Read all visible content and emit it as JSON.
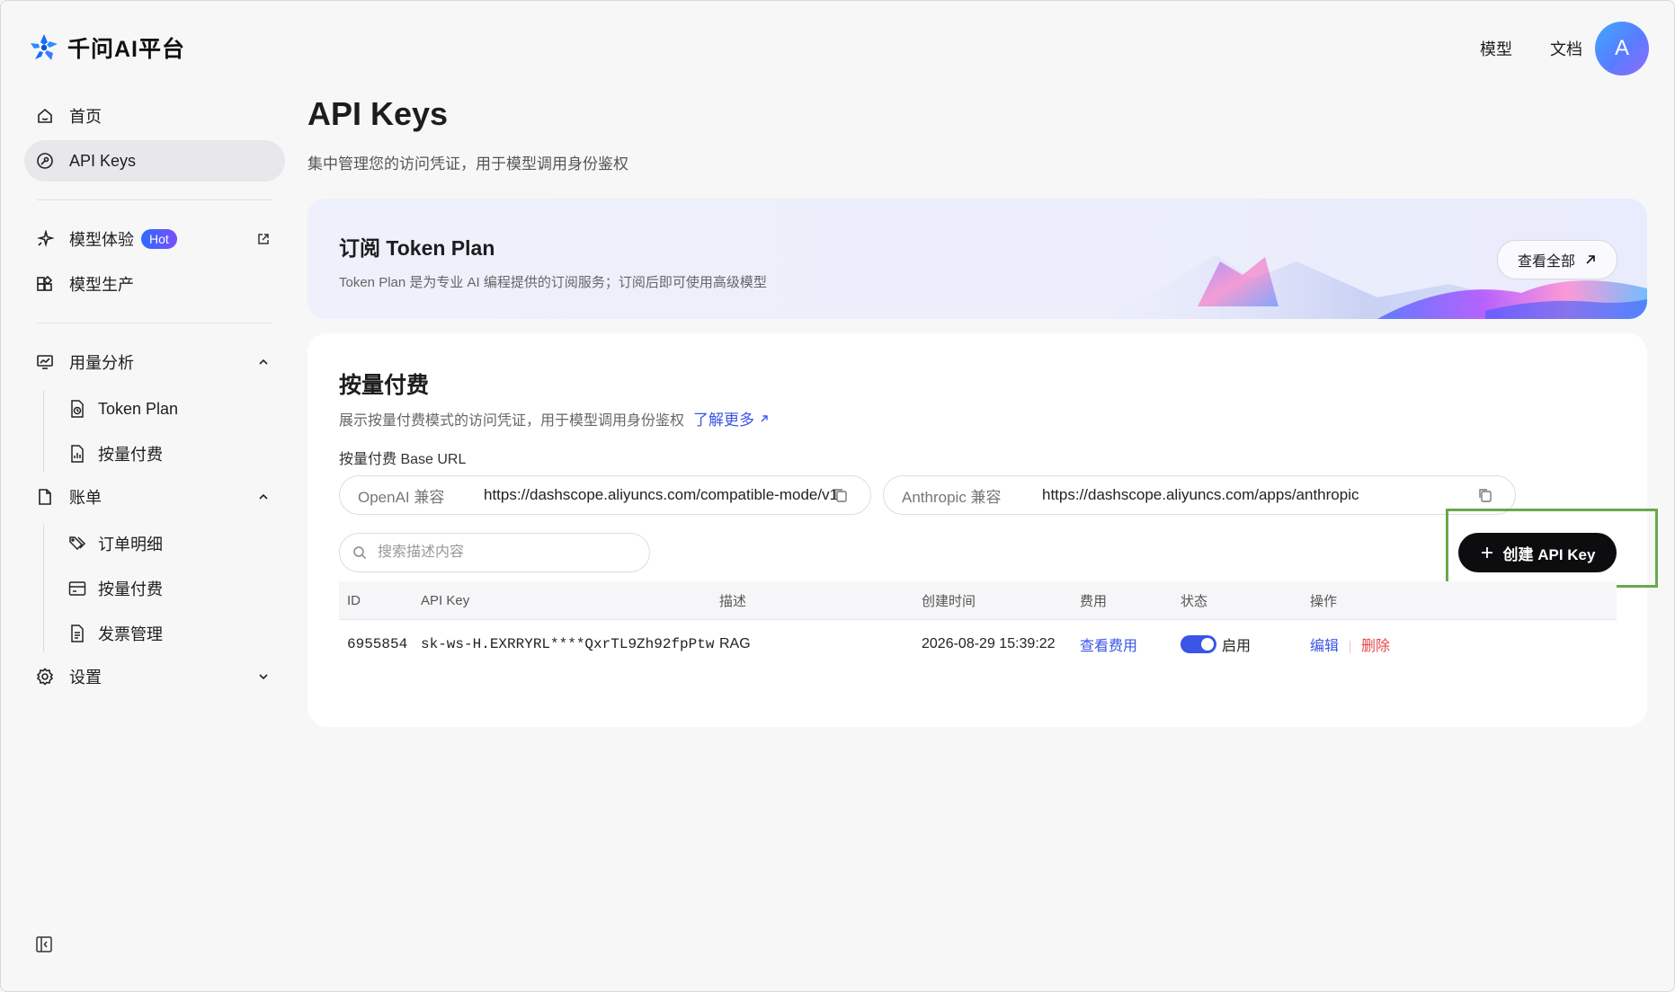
{
  "app": {
    "logo_text": "千问AI平台"
  },
  "topnav": {
    "models": "模型",
    "docs": "文档",
    "avatar_letter": "A"
  },
  "sidebar": {
    "items": [
      {
        "label": "首页",
        "icon": "home-icon"
      },
      {
        "label": "API Keys",
        "icon": "key-icon",
        "active": true
      },
      {
        "label": "模型体验",
        "icon": "sparkle-icon",
        "badge": "Hot",
        "trail_icon": "external-link-icon"
      },
      {
        "label": "模型生产",
        "icon": "blocks-icon"
      }
    ],
    "usage": {
      "label": "用量分析",
      "children": [
        {
          "label": "Token Plan",
          "icon": "token-doc-icon"
        },
        {
          "label": "按量付费",
          "icon": "chart-doc-icon"
        }
      ]
    },
    "billing": {
      "label": "账单",
      "children": [
        {
          "label": "订单明细",
          "icon": "tags-icon"
        },
        {
          "label": "按量付费",
          "icon": "card-icon"
        },
        {
          "label": "发票管理",
          "icon": "invoice-icon"
        }
      ]
    },
    "settings": {
      "label": "设置"
    }
  },
  "main": {
    "title": "API Keys",
    "subtitle": "集中管理您的访问凭证，用于模型调用身份鉴权",
    "banner": {
      "title": "订阅 Token Plan",
      "desc": "Token Plan 是为专业 AI 编程提供的订阅服务；订阅后即可使用高级模型",
      "button": "查看全部"
    },
    "payg": {
      "title": "按量付费",
      "subtitle": "展示按量付费模式的访问凭证，用于模型调用身份鉴权",
      "learn_more": "了解更多",
      "base_url_label": "按量付费 Base URL",
      "openai_tag": "OpenAI 兼容",
      "openai_url": "https://dashscope.aliyuncs.com/compatible-mode/v1",
      "anthropic_tag": "Anthropic 兼容",
      "anthropic_url": "https://dashscope.aliyuncs.com/apps/anthropic",
      "search_placeholder": "搜索描述内容",
      "create_button": "创建 API Key",
      "columns": [
        "ID",
        "API Key",
        "描述",
        "创建时间",
        "费用",
        "状态",
        "操作"
      ],
      "rows": [
        {
          "id": "6955854",
          "key": "sk-ws-H.EXRRYRL****QxrTL9Zh92fpPtw",
          "desc": "RAG",
          "created": "2026-08-29 15:39:22",
          "cost_link": "查看费用",
          "status": "启用",
          "enabled": true,
          "edit": "编辑",
          "delete": "删除"
        }
      ]
    }
  },
  "colors": {
    "accent": "#3b55e6",
    "danger": "#e5484d",
    "highlight": "#6aa84f",
    "create_button_bg": "#0d0d0f"
  }
}
